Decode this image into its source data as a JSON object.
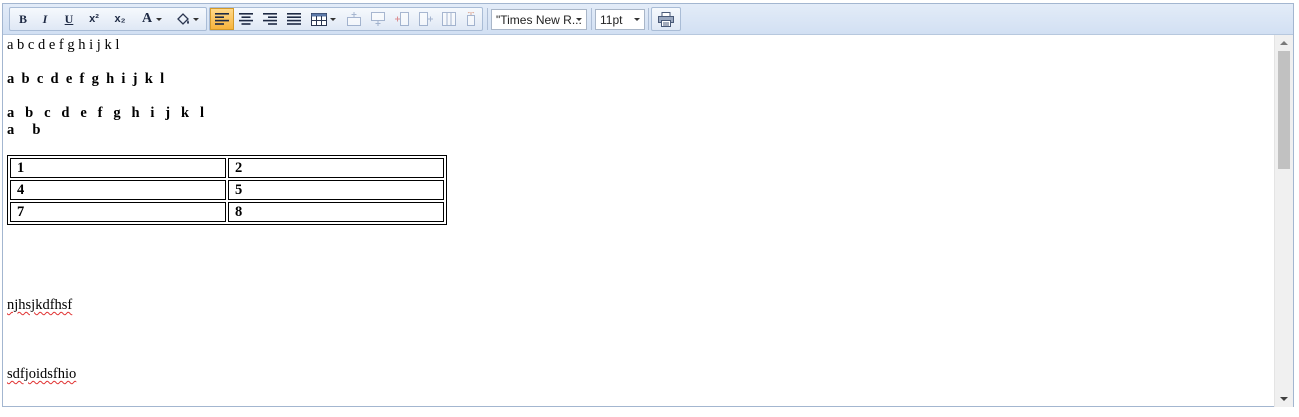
{
  "toolbar": {
    "bold_glyph": "B",
    "italic_glyph": "I",
    "underline_glyph": "U",
    "superscript_glyph": "x²",
    "subscript_glyph": "x₂",
    "fontcolor_glyph": "A",
    "font_family": "\"Times New R...",
    "font_size": "11pt",
    "active_alignment": "align-left"
  },
  "content": {
    "line1": "a b c d e f g h i j k l",
    "line2": "a  b  c  d  e  f  g  h  i  j  k  l",
    "line3": "a   b   c   d   e   f   g   h   i   j   k   l",
    "line4": "a     b",
    "table": [
      [
        "1",
        "2"
      ],
      [
        "4",
        "5"
      ],
      [
        "7",
        "8"
      ]
    ],
    "text1": "njhsjkdfhsf",
    "text2": "sdfjoidsfhio"
  },
  "colors": {
    "toolbar_bg": "#d2e0f3",
    "active_button": "#f7b33c",
    "spellcheck_underline": "#e03030"
  }
}
